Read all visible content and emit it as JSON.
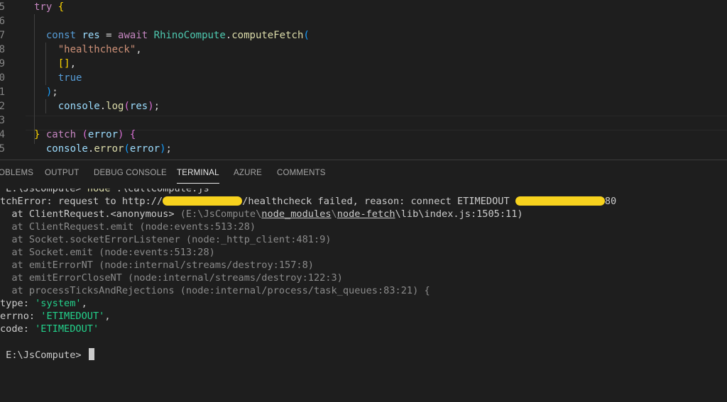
{
  "editor": {
    "lines": [
      {
        "num": "5",
        "tokens": [
          {
            "t": "try",
            "c": "tk-keyword"
          },
          {
            "t": " "
          },
          {
            "t": "{",
            "c": "tk-p1"
          }
        ]
      },
      {
        "num": "6",
        "tokens": []
      },
      {
        "num": "7",
        "tokens": [
          {
            "t": "  "
          },
          {
            "t": "const",
            "c": "tk-storage"
          },
          {
            "t": " "
          },
          {
            "t": "res",
            "c": "tk-var"
          },
          {
            "t": " = "
          },
          {
            "t": "await",
            "c": "tk-keyword"
          },
          {
            "t": " "
          },
          {
            "t": "RhinoCompute",
            "c": "tk-class"
          },
          {
            "t": "."
          },
          {
            "t": "computeFetch",
            "c": "tk-func"
          },
          {
            "t": "(",
            "c": "tk-p3"
          }
        ]
      },
      {
        "num": "8",
        "tokens": [
          {
            "t": "    "
          },
          {
            "t": "\"healthcheck\"",
            "c": "tk-string"
          },
          {
            "t": ","
          }
        ]
      },
      {
        "num": "9",
        "tokens": [
          {
            "t": "    "
          },
          {
            "t": "[]",
            "c": "tk-p1"
          },
          {
            "t": ","
          }
        ]
      },
      {
        "num": "0",
        "tokens": [
          {
            "t": "    "
          },
          {
            "t": "true",
            "c": "tk-bool"
          }
        ]
      },
      {
        "num": "1",
        "tokens": [
          {
            "t": "  "
          },
          {
            "t": ")",
            "c": "tk-p3"
          },
          {
            "t": ";"
          }
        ]
      },
      {
        "num": "2",
        "tokens": [
          {
            "t": "    "
          },
          {
            "t": "console",
            "c": "tk-var"
          },
          {
            "t": "."
          },
          {
            "t": "log",
            "c": "tk-func"
          },
          {
            "t": "(",
            "c": "tk-p2"
          },
          {
            "t": "res",
            "c": "tk-var"
          },
          {
            "t": ")",
            "c": "tk-p2"
          },
          {
            "t": ";"
          }
        ]
      },
      {
        "num": "3",
        "tokens": []
      },
      {
        "num": "4",
        "tokens": [
          {
            "t": "} ",
            "c": "tk-p1"
          },
          {
            "t": "catch",
            "c": "tk-keyword"
          },
          {
            "t": " "
          },
          {
            "t": "(",
            "c": "tk-p2"
          },
          {
            "t": "error",
            "c": "tk-var"
          },
          {
            "t": ")",
            "c": "tk-p2"
          },
          {
            "t": " "
          },
          {
            "t": "{",
            "c": "tk-p2"
          }
        ]
      },
      {
        "num": "5",
        "tokens": [
          {
            "t": "  "
          },
          {
            "t": "console",
            "c": "tk-var"
          },
          {
            "t": "."
          },
          {
            "t": "error",
            "c": "tk-func"
          },
          {
            "t": "(",
            "c": "tk-p3"
          },
          {
            "t": "error",
            "c": "tk-var"
          },
          {
            "t": ")",
            "c": "tk-p3"
          },
          {
            "t": ";"
          }
        ]
      }
    ]
  },
  "panel": {
    "tabs": [
      {
        "label": "OBLEMS",
        "name": "tab-problems"
      },
      {
        "label": "OUTPUT",
        "name": "tab-output"
      },
      {
        "label": "DEBUG CONSOLE",
        "name": "tab-debug-console"
      },
      {
        "label": "TERMINAL",
        "name": "tab-terminal",
        "active": true
      },
      {
        "label": "AZURE",
        "name": "tab-azure"
      },
      {
        "label": "COMMENTS",
        "name": "tab-comments"
      }
    ]
  },
  "terminal": {
    "lines": [
      {
        "segs": [
          {
            "t": " E:\\JsCompute> "
          },
          {
            "t": "node ",
            "c": "tk-func"
          },
          {
            "t": ".\\callCompute.js"
          }
        ]
      },
      {
        "segs": [
          {
            "t": "tchError: request to http://"
          },
          {
            "redact": true
          },
          {
            "t": "/healthcheck failed, reason: connect ETIMEDOUT "
          },
          {
            "redact": true
          },
          {
            "t": "80"
          }
        ]
      },
      {
        "segs": [
          {
            "t": "  at ClientRequest.<anonymous> "
          },
          {
            "t": "(E:\\JsCompute\\",
            "c": "dim"
          },
          {
            "t": "node_modules",
            "c": "link"
          },
          {
            "t": "\\",
            "c": "dim"
          },
          {
            "t": "node-fetch",
            "c": "link"
          },
          {
            "t": "\\lib\\index.js:1505:11)"
          }
        ]
      },
      {
        "segs": [
          {
            "t": "  at ClientRequest.emit (node:events:513:28)",
            "c": "dim"
          }
        ]
      },
      {
        "segs": [
          {
            "t": "  at Socket.socketErrorListener (node:_http_client:481:9)",
            "c": "dim"
          }
        ]
      },
      {
        "segs": [
          {
            "t": "  at Socket.emit (node:events:513:28)",
            "c": "dim"
          }
        ]
      },
      {
        "segs": [
          {
            "t": "  at emitErrorNT (node:internal/streams/destroy:157:8)",
            "c": "dim"
          }
        ]
      },
      {
        "segs": [
          {
            "t": "  at emitErrorCloseNT (node:internal/streams/destroy:122:3)",
            "c": "dim"
          }
        ]
      },
      {
        "segs": [
          {
            "t": "  at processTicksAndRejections (node:internal/process/task_queues:83:21) {",
            "c": "dim"
          }
        ]
      },
      {
        "segs": [
          {
            "t": "type: "
          },
          {
            "t": "'system'",
            "c": "t-green"
          },
          {
            "t": ","
          }
        ]
      },
      {
        "segs": [
          {
            "t": "errno: "
          },
          {
            "t": "'ETIMEDOUT'",
            "c": "t-green"
          },
          {
            "t": ","
          }
        ]
      },
      {
        "segs": [
          {
            "t": "code: "
          },
          {
            "t": "'ETIMEDOUT'",
            "c": "t-green"
          }
        ]
      },
      {
        "segs": []
      },
      {
        "segs": [
          {
            "t": " E:\\JsCompute> "
          },
          {
            "cursor": true
          }
        ]
      }
    ]
  }
}
